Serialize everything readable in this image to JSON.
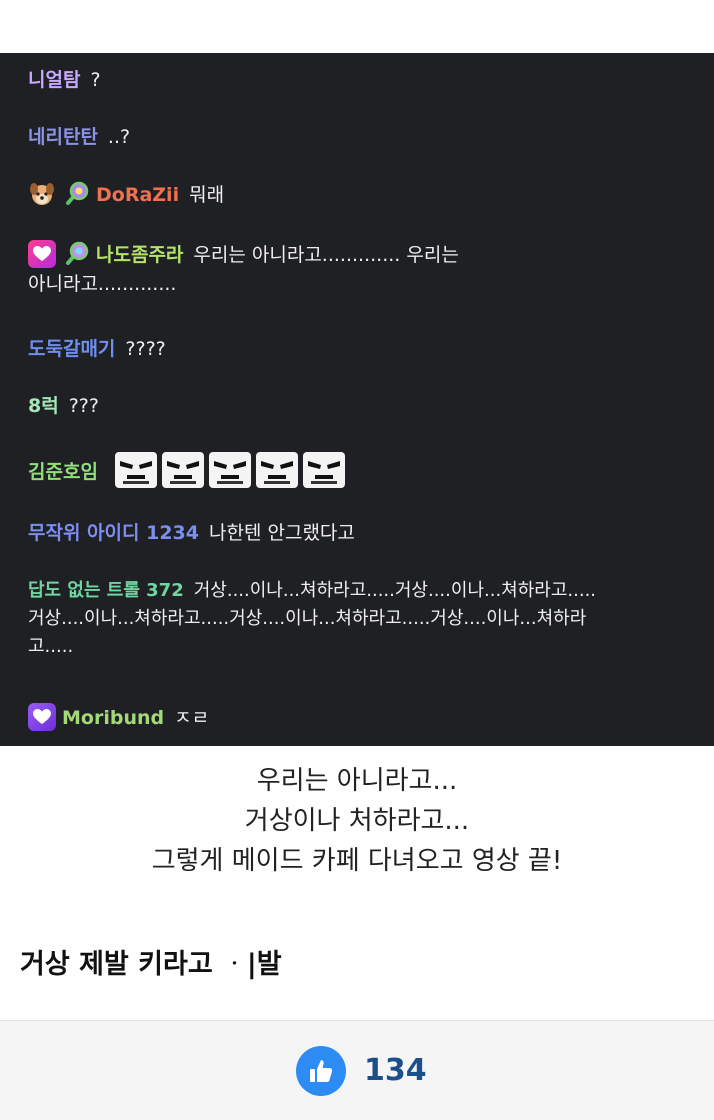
{
  "chat": {
    "messages": [
      {
        "nick": "니얼탐",
        "nick_color": "#c7a9ff",
        "text": "?"
      },
      {
        "nick": "네리탄탄",
        "nick_color": "#8b93e6",
        "text": "..?"
      },
      {
        "nick": "DoRaZii",
        "nick_color": "#f0714f",
        "text": "뭐래"
      },
      {
        "nick": "나도좀주라",
        "nick_color": "#b5e36a",
        "text": "우리는 아니라고............. 우리는",
        "text2": "아니라고............."
      },
      {
        "nick": "도둑갈매기",
        "nick_color": "#6f8ff0",
        "text": "????"
      },
      {
        "nick": "8럭",
        "nick_color": "#a8e6b8",
        "text": "???"
      },
      {
        "nick": "김준호임",
        "nick_color": "#8fe07a",
        "text": ""
      },
      {
        "nick": "무작위 아이디 1234",
        "nick_color": "#7c8ef0",
        "text": "나한텐 안그랬다고"
      },
      {
        "nick": "답도 없는 트롤 372",
        "nick_color": "#6fd6a0",
        "text": "거상....이나...쳐하라고.....거상....이나...쳐하라고.....",
        "text2": "거상....이나...쳐하라고.....거상....이나...쳐하라고.....거상....이나...쳐하라",
        "text3": "고....."
      },
      {
        "nick": "Moribund",
        "nick_color": "#a3d977",
        "text": "ㅈㄹ"
      }
    ]
  },
  "caption": {
    "line1": "우리는 아니라고...",
    "line2": "거상이나 처하라고...",
    "line3": "그렇게 메이드 카페 다녀오고 영상 끝!"
  },
  "post_line": "거상 제발 키라고 ᆞ|발",
  "like": {
    "count": "134",
    "color": "#2c8cf4"
  },
  "icons": [
    "dog-face-icon",
    "magnifier-badge-icon",
    "heart-badge-icon",
    "meme-face-emote-icon",
    "thumbs-up-icon"
  ]
}
